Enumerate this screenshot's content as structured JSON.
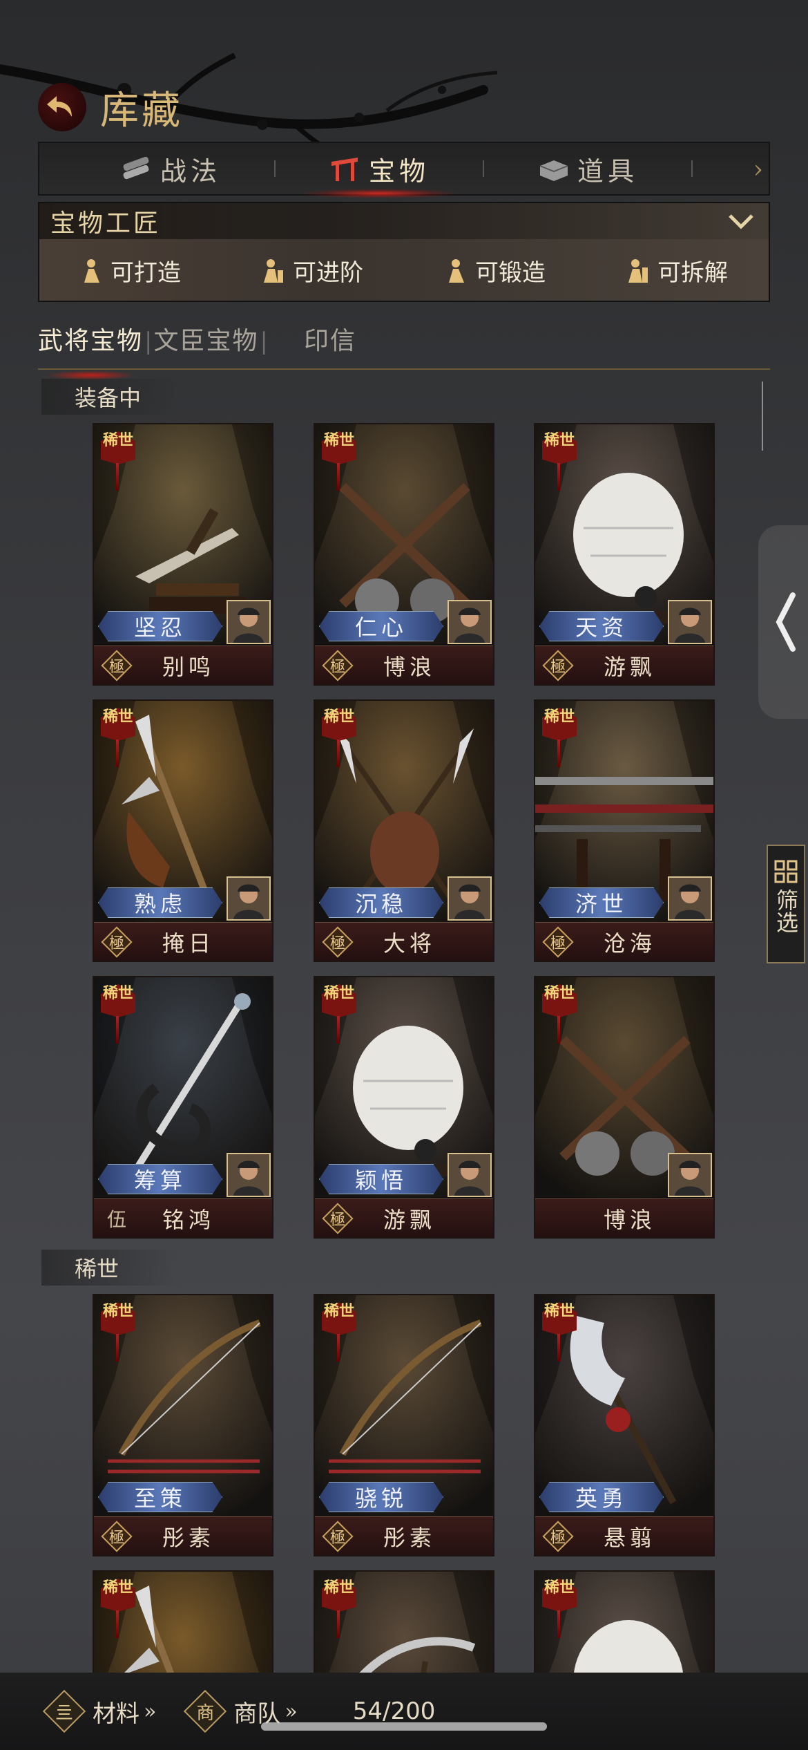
{
  "header": {
    "title": "库藏"
  },
  "tabs": [
    {
      "label": "战法",
      "icon": "scroll-bundle-icon",
      "active": false
    },
    {
      "label": "宝物",
      "icon": "treasure-gate-icon",
      "active": true
    },
    {
      "label": "道具",
      "icon": "chest-icon",
      "active": false
    }
  ],
  "craftsman": {
    "title": "宝物工匠",
    "actions": [
      {
        "label": "可打造",
        "icon": "forge-figure-icon"
      },
      {
        "label": "可进阶",
        "icon": "upgrade-figure-icon"
      },
      {
        "label": "可锻造",
        "icon": "anvil-figure-icon"
      },
      {
        "label": "可拆解",
        "icon": "dismantle-figure-icon"
      }
    ]
  },
  "subtabs": [
    {
      "label": "武将宝物",
      "active": true
    },
    {
      "label": "文臣宝物",
      "active": false
    },
    {
      "label": "印信",
      "active": false
    }
  ],
  "sections": [
    {
      "label": "装备中"
    },
    {
      "label": "稀世"
    }
  ],
  "rarity_label": "稀世",
  "grade_glyph": "極",
  "cards": [
    {
      "trait": "坚忍",
      "name": "别鸣",
      "grade": "极",
      "art": "dagger",
      "portrait": true,
      "theme": "#6a5a3a"
    },
    {
      "trait": "仁心",
      "name": "博浪",
      "grade": "极",
      "art": "maces",
      "portrait": true,
      "theme": "#5a4a32"
    },
    {
      "trait": "天资",
      "name": "游飘",
      "grade": "极",
      "art": "feather-fan",
      "portrait": true,
      "theme": "#5c5048"
    },
    {
      "trait": "熟虑",
      "name": "掩日",
      "grade": "极",
      "art": "halberd",
      "portrait": true,
      "theme": "#7a5a2a"
    },
    {
      "trait": "沉稳",
      "name": "大将",
      "grade": "极",
      "art": "crossed-spears",
      "portrait": true,
      "theme": "#6a5230"
    },
    {
      "trait": "济世",
      "name": "沧海",
      "grade": "极",
      "art": "sword-rack",
      "portrait": true,
      "theme": "#6a5a42"
    },
    {
      "trait": "筹算",
      "name": "铭鸿",
      "grade": "伍",
      "art": "dragon-sword",
      "portrait": true,
      "theme": "#3a4048"
    },
    {
      "trait": "颖悟",
      "name": "游飘",
      "grade": "极",
      "art": "feather-fan",
      "portrait": true,
      "theme": "#5c5048"
    },
    {
      "trait": "",
      "name": "博浪",
      "grade": "",
      "art": "maces",
      "portrait": true,
      "theme": "#5a4a32"
    },
    {
      "trait": "至策",
      "name": "彤素",
      "grade": "极",
      "art": "bow",
      "portrait": false,
      "theme": "#5a4a36"
    },
    {
      "trait": "骁锐",
      "name": "彤素",
      "grade": "极",
      "art": "bow",
      "portrait": false,
      "theme": "#5a4a36"
    },
    {
      "trait": "英勇",
      "name": "悬翦",
      "grade": "极",
      "art": "glaive",
      "portrait": false,
      "theme": "#4a4240"
    },
    {
      "trait": "",
      "name": "",
      "grade": "",
      "art": "halberd",
      "portrait": false,
      "theme": "#7a5a2a"
    },
    {
      "trait": "",
      "name": "",
      "grade": "",
      "art": "curved-blade",
      "portrait": false,
      "theme": "#5a4a3a"
    },
    {
      "trait": "",
      "name": "",
      "grade": "",
      "art": "feather-fan",
      "portrait": false,
      "theme": "#5c5048"
    }
  ],
  "filter": {
    "label": "筛选"
  },
  "bottom": {
    "materials_label": "材料",
    "materials_icon_glyph": "亖",
    "caravan_label": "商队",
    "caravan_icon_glyph": "商",
    "chevrons": "»",
    "count": "54/200"
  }
}
